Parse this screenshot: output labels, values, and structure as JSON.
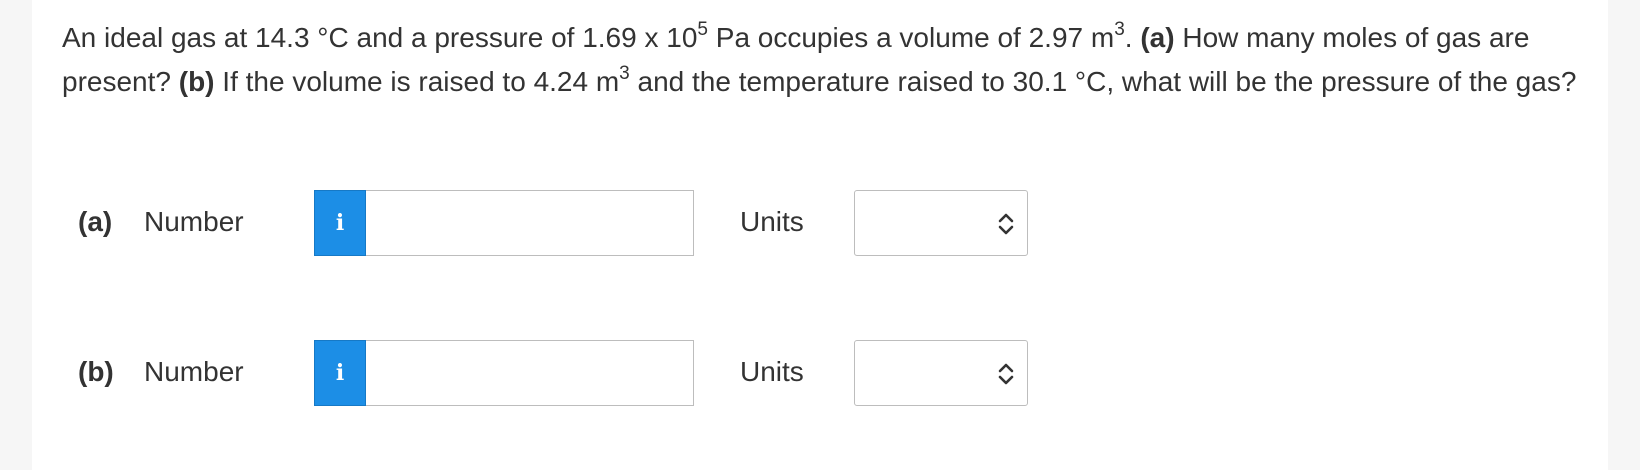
{
  "question": {
    "p1": "An ideal gas at ",
    "t1": "14.3",
    "deg1": " °C and a pressure of ",
    "p_mant": "1.69 x 10",
    "p_exp": "5",
    "pa": " Pa occupies a volume of ",
    "v1": "2.97 m",
    "v1_exp": "3",
    "dot": ".",
    "part_a_tag": "(a)",
    "part_a_text": " How many moles of gas are present? ",
    "part_b_tag": "(b)",
    "part_b_text": " If the volume is raised to ",
    "v2": "4.24 m",
    "v2_exp": "3",
    "mid": " and the temperature raised to ",
    "t2": "30.1",
    "end": " °C, what will be the pressure of the gas?"
  },
  "answers": [
    {
      "part_label": "(a)",
      "number_label": "Number",
      "info_icon": "i",
      "number_value": "",
      "units_label": "Units",
      "units_value": ""
    },
    {
      "part_label": "(b)",
      "number_label": "Number",
      "info_icon": "i",
      "number_value": "",
      "units_label": "Units",
      "units_value": ""
    }
  ],
  "colors": {
    "info_button": "#1c8ee6",
    "text": "#333333",
    "background": "#f6f6f6"
  }
}
